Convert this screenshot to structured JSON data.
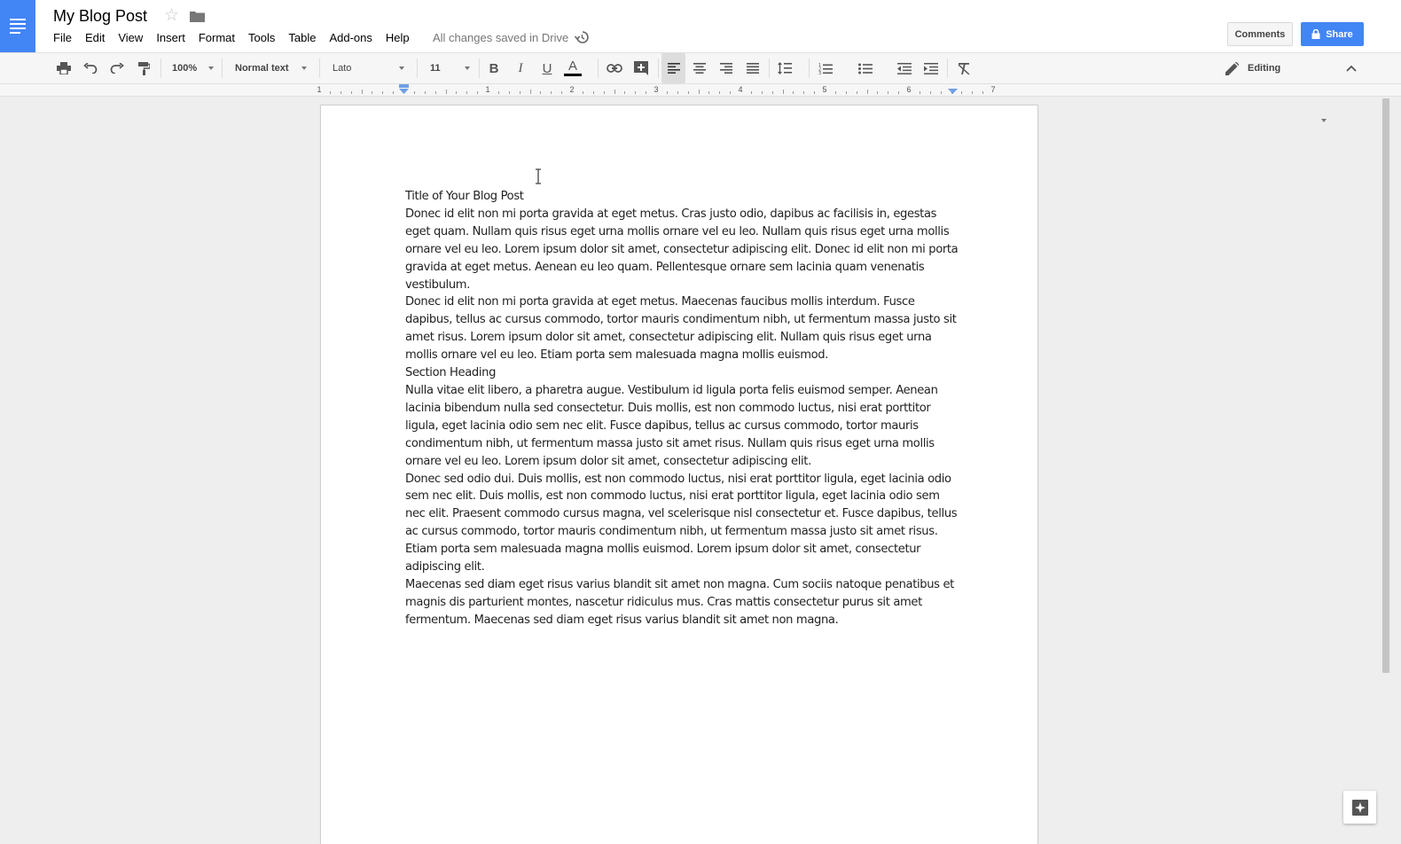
{
  "doc": {
    "title": "My Blog Post",
    "save_status": "All changes saved in Drive"
  },
  "menu": [
    "File",
    "Edit",
    "View",
    "Insert",
    "Format",
    "Tools",
    "Table",
    "Add-ons",
    "Help"
  ],
  "buttons": {
    "comments": "Comments",
    "share": "Share"
  },
  "toolbar": {
    "zoom": "100%",
    "style": "Normal text",
    "font": "Lato",
    "size": "11",
    "mode": "Editing"
  },
  "ruler": {
    "labels": [
      "1",
      "1",
      "2",
      "3",
      "4",
      "5",
      "6",
      "7"
    ]
  },
  "content": {
    "paragraphs": [
      "Title of Your Blog Post",
      "Donec id elit non mi porta gravida at eget metus. Cras justo odio, dapibus ac facilisis in, egestas eget quam. Nullam quis risus eget urna mollis ornare vel eu leo. Nullam quis risus eget urna mollis ornare vel eu leo. Lorem ipsum dolor sit amet, consectetur adipiscing elit. Donec id elit non mi porta gravida at eget metus. Aenean eu leo quam. Pellentesque ornare sem lacinia quam venenatis vestibulum.",
      "Donec id elit non mi porta gravida at eget metus. Maecenas faucibus mollis interdum. Fusce dapibus, tellus ac cursus commodo, tortor mauris condimentum nibh, ut fermentum massa justo sit amet risus. Lorem ipsum dolor sit amet, consectetur adipiscing elit. Nullam quis risus eget urna mollis ornare vel eu leo. Etiam porta sem malesuada magna mollis euismod.",
      "Section Heading",
      "Nulla vitae elit libero, a pharetra augue. Vestibulum id ligula porta felis euismod semper. Aenean lacinia bibendum nulla sed consectetur. Duis mollis, est non commodo luctus, nisi erat porttitor ligula, eget lacinia odio sem nec elit. Fusce dapibus, tellus ac cursus commodo, tortor mauris condimentum nibh, ut fermentum massa justo sit amet risus. Nullam quis risus eget urna mollis ornare vel eu leo. Lorem ipsum dolor sit amet, consectetur adipiscing elit.",
      "Donec sed odio dui. Duis mollis, est non commodo luctus, nisi erat porttitor ligula, eget lacinia odio sem nec elit. Duis mollis, est non commodo luctus, nisi erat porttitor ligula, eget lacinia odio sem nec elit. Praesent commodo cursus magna, vel scelerisque nisl consectetur et. Fusce dapibus, tellus ac cursus commodo, tortor mauris condimentum nibh, ut fermentum massa justo sit amet risus. Etiam porta sem malesuada magna mollis euismod. Lorem ipsum dolor sit amet, consectetur adipiscing elit.",
      "Maecenas sed diam eget risus varius blandit sit amet non magna. Cum sociis natoque penatibus et magnis dis parturient montes, nascetur ridiculus mus. Cras mattis consectetur purus sit amet fermentum. Maecenas sed diam eget risus varius blandit sit amet non magna."
    ]
  },
  "colors": {
    "brand": "#4285f4",
    "text_color_bar": "#000000"
  },
  "icons": [
    "docs-logo-icon",
    "star-icon",
    "folder-icon",
    "history-icon",
    "lock-icon",
    "print-icon",
    "undo-icon",
    "redo-icon",
    "paint-format-icon",
    "bold-icon",
    "italic-icon",
    "underline-icon",
    "text-color-icon",
    "link-icon",
    "insert-comment-icon",
    "align-left-icon",
    "align-center-icon",
    "align-right-icon",
    "align-justify-icon",
    "line-spacing-icon",
    "numbered-list-icon",
    "bulleted-list-icon",
    "decrease-indent-icon",
    "increase-indent-icon",
    "clear-formatting-icon",
    "pencil-icon",
    "collapse-icon",
    "explore-icon"
  ]
}
